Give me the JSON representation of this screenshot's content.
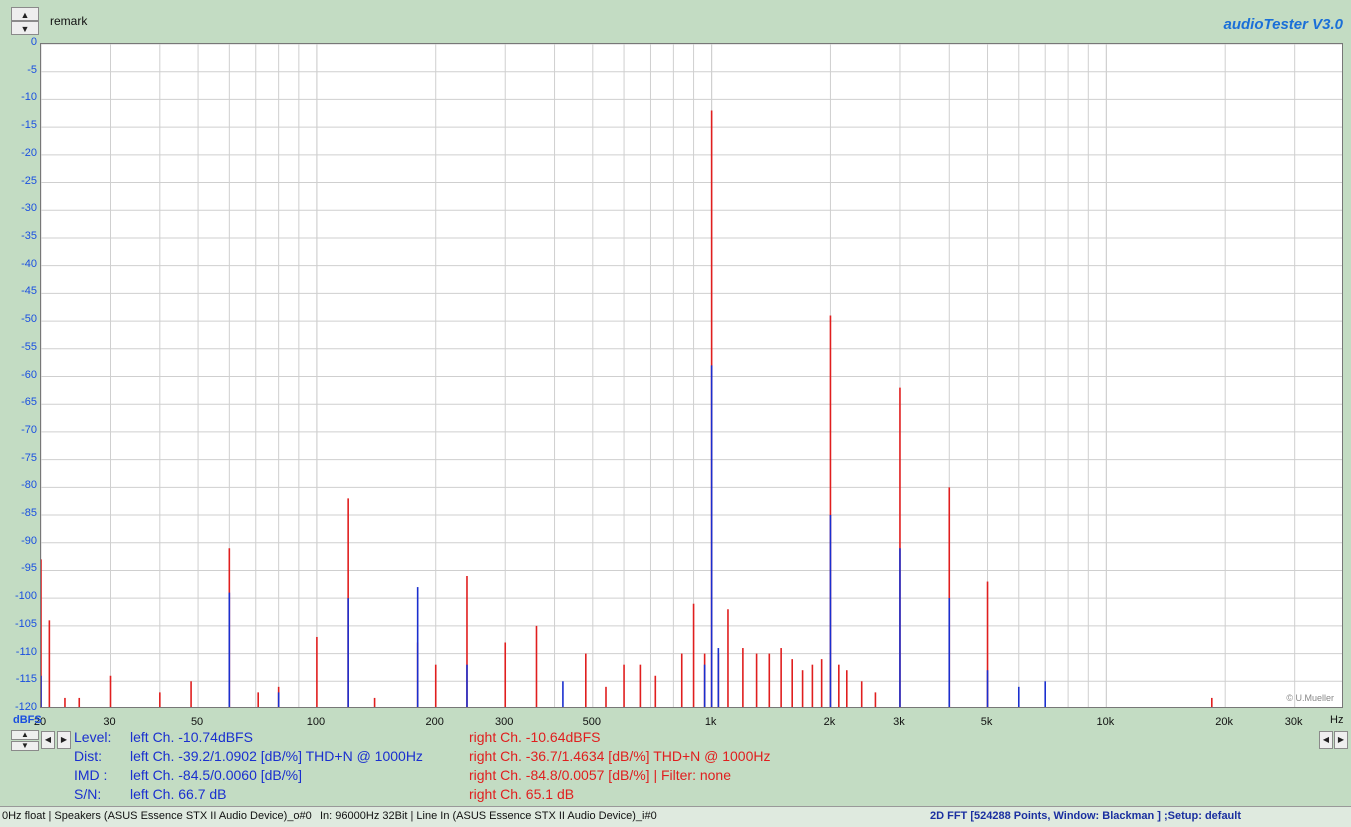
{
  "app": {
    "brand": "audioTester  V3.0",
    "remark": "remark",
    "copyright": "© U.Mueller"
  },
  "colors": {
    "left": "#1a2fcf",
    "right": "#e01e1e",
    "grid": "#cfcfcf",
    "background": "#c3dcc3"
  },
  "chart_data": {
    "type": "line",
    "xscale": "log",
    "xlim": [
      20,
      40000
    ],
    "ylim": [
      -120,
      0
    ],
    "yunit": "dBFS",
    "xunit": "Hz",
    "yticks": [
      0,
      -5,
      -10,
      -15,
      -20,
      -25,
      -30,
      -35,
      -40,
      -45,
      -50,
      -55,
      -60,
      -65,
      -70,
      -75,
      -80,
      -85,
      -90,
      -95,
      -100,
      -105,
      -110,
      -115,
      -120
    ],
    "xticks": [
      {
        "v": 30,
        "label": "30"
      },
      {
        "v": 50,
        "label": "50"
      },
      {
        "v": 100,
        "label": "100"
      },
      {
        "v": 200,
        "label": "200"
      },
      {
        "v": 300,
        "label": "300"
      },
      {
        "v": 500,
        "label": "500"
      },
      {
        "v": 1000,
        "label": "1k"
      },
      {
        "v": 2000,
        "label": "2k"
      },
      {
        "v": 3000,
        "label": "3k"
      },
      {
        "v": 5000,
        "label": "5k"
      },
      {
        "v": 10000,
        "label": "10k"
      },
      {
        "v": 20000,
        "label": "20k"
      },
      {
        "v": 30000,
        "label": "30k"
      }
    ],
    "first_tick_label": "20",
    "series": [
      {
        "name": "right Ch.",
        "color": "#e01e1e",
        "peaks": [
          [
            20,
            -93
          ],
          [
            21,
            -104
          ],
          [
            23,
            -118
          ],
          [
            25,
            -118
          ],
          [
            30,
            -114
          ],
          [
            40,
            -117
          ],
          [
            48,
            -115
          ],
          [
            60,
            -91
          ],
          [
            71,
            -117
          ],
          [
            80,
            -116
          ],
          [
            100,
            -107
          ],
          [
            120,
            -82
          ],
          [
            140,
            -118
          ],
          [
            180,
            -108
          ],
          [
            200,
            -112
          ],
          [
            240,
            -96
          ],
          [
            300,
            -108
          ],
          [
            360,
            -105
          ],
          [
            480,
            -110
          ],
          [
            540,
            -116
          ],
          [
            600,
            -112
          ],
          [
            660,
            -112
          ],
          [
            720,
            -114
          ],
          [
            840,
            -110
          ],
          [
            900,
            -101
          ],
          [
            960,
            -110
          ],
          [
            1000,
            -12
          ],
          [
            1040,
            -110
          ],
          [
            1100,
            -102
          ],
          [
            1200,
            -109
          ],
          [
            1300,
            -110
          ],
          [
            1400,
            -110
          ],
          [
            1500,
            -109
          ],
          [
            1600,
            -111
          ],
          [
            1700,
            -113
          ],
          [
            1800,
            -112
          ],
          [
            1900,
            -111
          ],
          [
            2000,
            -49
          ],
          [
            2100,
            -112
          ],
          [
            2200,
            -113
          ],
          [
            2400,
            -115
          ],
          [
            2600,
            -117
          ],
          [
            3000,
            -62
          ],
          [
            4000,
            -80
          ],
          [
            5000,
            -97
          ],
          [
            18500,
            -118
          ]
        ]
      },
      {
        "name": "left Ch.",
        "color": "#1a2fcf",
        "peaks": [
          [
            20,
            -114
          ],
          [
            60,
            -99
          ],
          [
            80,
            -117
          ],
          [
            120,
            -100
          ],
          [
            180,
            -98
          ],
          [
            240,
            -112
          ],
          [
            420,
            -115
          ],
          [
            960,
            -112
          ],
          [
            1000,
            -58
          ],
          [
            1040,
            -109
          ],
          [
            2000,
            -85
          ],
          [
            3000,
            -91
          ],
          [
            4000,
            -100
          ],
          [
            5000,
            -113
          ],
          [
            6000,
            -116
          ],
          [
            7000,
            -115
          ]
        ]
      }
    ]
  },
  "measurements": {
    "rows": [
      {
        "label": "Level:",
        "left": "left Ch. -10.74dBFS",
        "right": "right Ch. -10.64dBFS"
      },
      {
        "label": "Dist:",
        "left": "left Ch. -39.2/1.0902 [dB/%] THD+N  @ 1000Hz",
        "right": "right Ch. -36.7/1.4634 [dB/%] THD+N  @ 1000Hz"
      },
      {
        "label": "IMD  :",
        "left": "left Ch. -84.5/0.0060 [dB/%]",
        "right": "right Ch. -84.8/0.0057 [dB/%] |   Filter: none"
      },
      {
        "label": "S/N:",
        "left": "left Ch. 66.7 dB",
        "right": "right Ch. 65.1 dB"
      }
    ]
  },
  "status": {
    "out": "0Hz float  | Speakers (ASUS Essence STX II Audio Device)_o#0",
    "in": "In: 96000Hz 32Bit  | Line In (ASUS Essence STX II Audio Device)_i#0",
    "fft": "2D FFT [524288 Points, Window: Blackman ]  ;Setup:  default"
  },
  "icons": {
    "up": "triangle-up",
    "down": "triangle-down",
    "left": "triangle-left",
    "right": "triangle-right"
  }
}
